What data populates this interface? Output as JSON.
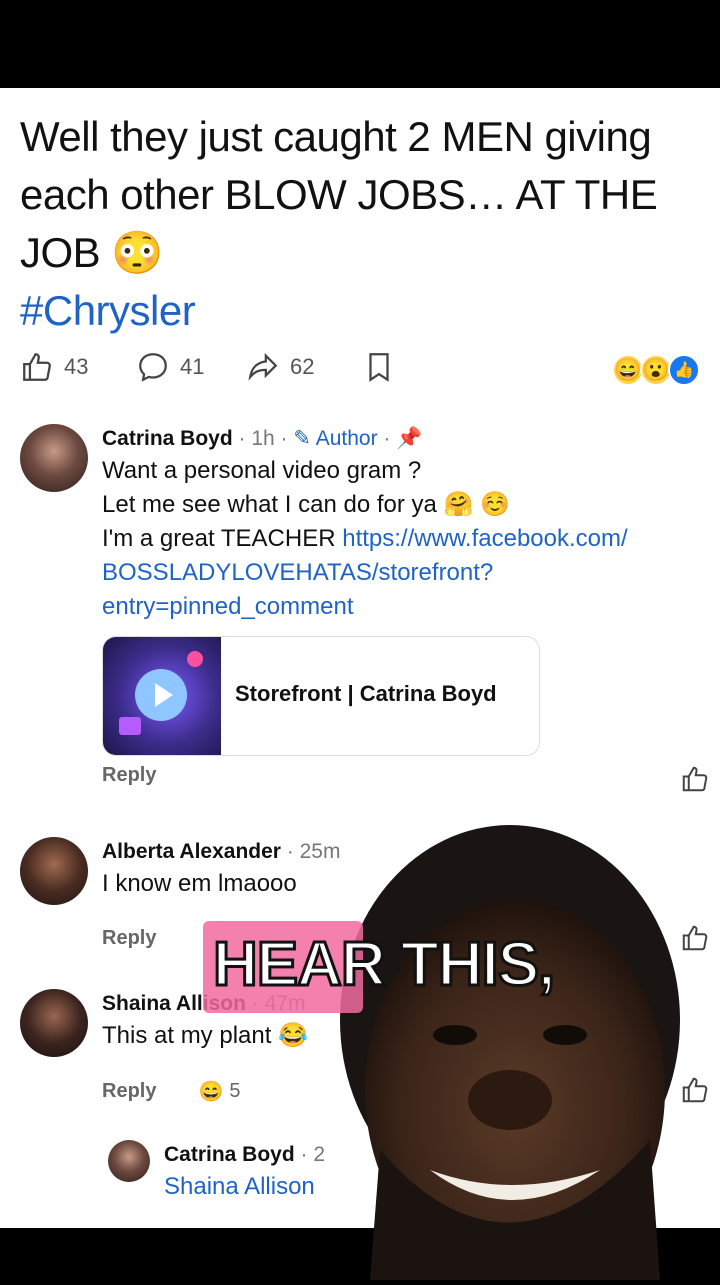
{
  "post": {
    "title": "Well they just caught 2 MEN giving each other BLOW JOBS… AT THE JOB 😳",
    "hashtag": "#Chrysler"
  },
  "actions": {
    "likes": "43",
    "comments": "41",
    "shares": "62",
    "reaction_emojis": [
      "😄",
      "😮",
      "👍"
    ]
  },
  "comments": [
    {
      "author": "Catrina Boyd",
      "time": "1h",
      "badge": "Author",
      "lines": [
        "Want a personal video gram ?",
        "Let me see what I can do for ya 🤗 ☺️",
        "I'm a great TEACHER "
      ],
      "link": "https://www.facebook.com/BOSSLADYLOVEHATAS/storefront?entry=pinned_comment",
      "link_line1": "https://www.facebook.com/",
      "link_line2": "BOSSLADYLOVEHATAS/storefront?",
      "link_line3": "entry=pinned_comment",
      "card_title": "Storefront | Catrina Boyd",
      "reply": "Reply"
    },
    {
      "author": "Alberta Alexander",
      "time": "25m",
      "text": "I know em lmaooo",
      "reply": "Reply"
    },
    {
      "author": "Shaina Allison",
      "time": "47m",
      "text": "This at my plant 😂",
      "reply": "Reply",
      "reaction_emoji": "😄",
      "reaction_count": "5"
    },
    {
      "author": "Catrina Boyd",
      "time": "2",
      "mention": "Shaina Allison"
    }
  ],
  "overlay": {
    "caption": "HEAR THIS,"
  }
}
